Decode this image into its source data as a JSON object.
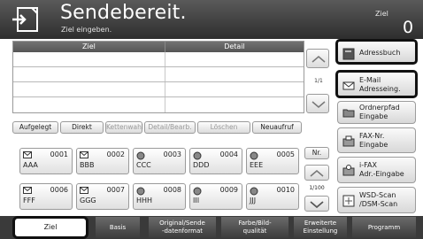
{
  "header": {
    "title": "Sendebereit.",
    "subtitle": "Ziel eingeben.",
    "ziel_label": "Ziel",
    "ziel_count": "0"
  },
  "destination_table": {
    "columns": [
      "Ziel",
      "Detail"
    ],
    "rows": 4,
    "pager": "1/1"
  },
  "right_buttons": [
    {
      "label": "Adressbuch",
      "icon": "address-book-icon",
      "selected": true
    },
    {
      "label": "E-Mail\nAdresseing.",
      "icon": "email-icon",
      "selected": true
    },
    {
      "label": "Ordnerpfad\nEingabe",
      "icon": "folder-icon",
      "selected": false
    },
    {
      "label": "FAX-Nr.\nEingabe",
      "icon": "fax-icon",
      "selected": false
    },
    {
      "label": "i-FAX\nAdr.-Eingabe",
      "icon": "ifax-icon",
      "selected": false
    },
    {
      "label": "WSD-Scan\n/DSM-Scan",
      "icon": "wsd-scan-icon",
      "selected": false
    }
  ],
  "tab_row": [
    {
      "label": "Aufgelegt",
      "disabled": false
    },
    {
      "label": "Direkt",
      "disabled": false
    },
    {
      "label": "Kettenwahl",
      "disabled": true
    },
    {
      "label": "Detail/Bearb.",
      "disabled": true
    },
    {
      "label": "Löschen",
      "disabled": true
    },
    {
      "label": "Neuaufruf",
      "disabled": false
    }
  ],
  "address_book": [
    {
      "num": "0001",
      "name": "AAA"
    },
    {
      "num": "0002",
      "name": "BBB"
    },
    {
      "num": "0003",
      "name": "CCC"
    },
    {
      "num": "0004",
      "name": "DDD"
    },
    {
      "num": "0005",
      "name": "EEE"
    },
    {
      "num": "0006",
      "name": "FFF"
    },
    {
      "num": "0007",
      "name": "GGG"
    },
    {
      "num": "0008",
      "name": "HHH"
    },
    {
      "num": "0009",
      "name": "III"
    },
    {
      "num": "0010",
      "name": "JJJ"
    }
  ],
  "address_nav": {
    "nr_label": "Nr.",
    "pager": "1/100"
  },
  "bottom_tabs": [
    {
      "label": "Ziel",
      "active": true
    },
    {
      "label": "Basis",
      "active": false
    },
    {
      "label": "Original/Sende\n-datenformat",
      "active": false
    },
    {
      "label": "Farbe/Bild-\nqualität",
      "active": false
    },
    {
      "label": "Erweiterte\nEinstellung",
      "active": false
    },
    {
      "label": "Programm",
      "active": false
    }
  ]
}
